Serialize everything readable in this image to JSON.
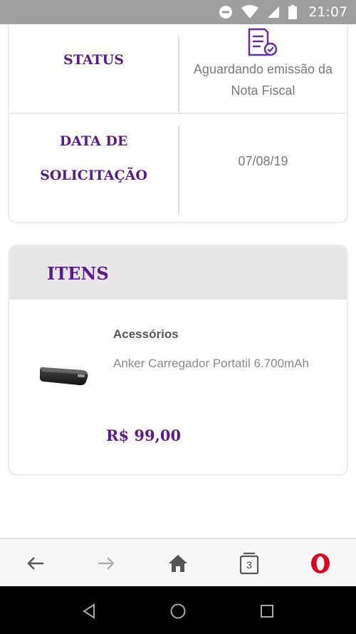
{
  "status_bar": {
    "time": "21:07"
  },
  "order": {
    "status_label": "STATUS",
    "status_value": "Aguardando emissão da Nota Fiscal",
    "date_label_line1": "DATA DE",
    "date_label_line2": "SOLICITAÇÃO",
    "date_value": "07/08/19"
  },
  "items": {
    "title": "ITENS",
    "list": [
      {
        "category": "Acessórios",
        "name": "Anker Carregador Portatil 6.700mAh",
        "price": "R$ 99,00"
      }
    ]
  },
  "toolbar": {
    "tabs_count": "3"
  },
  "colors": {
    "accent": "#5a1a8c",
    "opera_red": "#e3001b",
    "status_bar": "#9e9e9e"
  }
}
